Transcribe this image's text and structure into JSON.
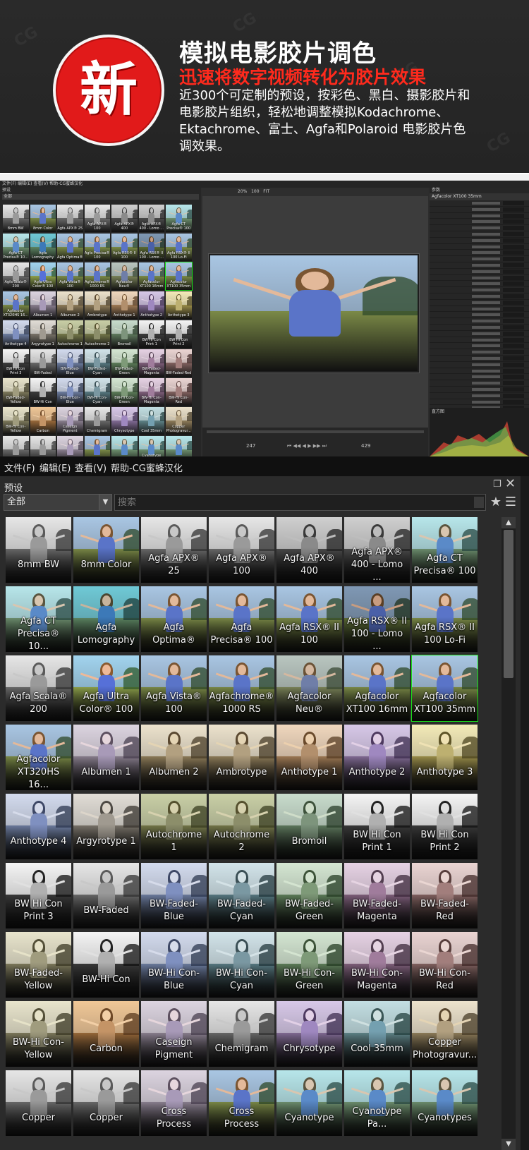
{
  "banner": {
    "badge": "新",
    "headline": "模拟电影胶片调色",
    "subheadline": "迅速将数字视频转化为胶片效果",
    "description": "近300个可定制的预设，按彩色、黑白、摄影胶片和电影胶片组织，轻松地调整模拟Kodachrome、Ektachrome、富士、Agfa和Polaroid 电影胶片色调效果。",
    "watermark": "CG"
  },
  "app_preview": {
    "menu": "文件(F)  编辑(E)  查看(V)  帮助-CG蜜蜂汉化",
    "left_header": "预设",
    "filter": "全部",
    "zoom": "20%",
    "zoom_step": "100",
    "fit": "FIT",
    "frame_in": "247",
    "frame_out": "429",
    "right_header": "参数",
    "preset_name": "Agfacolor XT100 35mm",
    "histogram_label": "直方图"
  },
  "menubar": {
    "items": [
      "文件(F)",
      "编辑(E)",
      "查看(V)",
      "帮助-CG蜜蜂汉化"
    ]
  },
  "presets_panel": {
    "title": "预设",
    "filter_value": "全部",
    "search_placeholder": "搜索",
    "selected_index": 20,
    "items": [
      {
        "label": "8mm BW",
        "tone": "bw"
      },
      {
        "label": "8mm Color",
        "tone": "color"
      },
      {
        "label": "Agfa APX® 25",
        "tone": "bw"
      },
      {
        "label": "Agfa APX® 100",
        "tone": "bw"
      },
      {
        "label": "Agfa APX® 400",
        "tone": "bwdark"
      },
      {
        "label": "Agfa APX® 400 - Lomo ...",
        "tone": "bwdark"
      },
      {
        "label": "Agfa CT Precisa® 100",
        "tone": "cyan"
      },
      {
        "label": "Agfa CT Precisa® 10...",
        "tone": "cyan"
      },
      {
        "label": "Agfa Lomography",
        "tone": "teal"
      },
      {
        "label": "Agfa Optima®",
        "tone": "color"
      },
      {
        "label": "Agfa Precisa® 100",
        "tone": "color"
      },
      {
        "label": "Agfa RSX® II 100",
        "tone": "color"
      },
      {
        "label": "Agfa RSX® II 100 - Lomo ...",
        "tone": "colordark"
      },
      {
        "label": "Agfa RSX® II 100 Lo-Fi",
        "tone": "color"
      },
      {
        "label": "Agfa Scala® 200",
        "tone": "bw"
      },
      {
        "label": "Agfa Ultra Color® 100",
        "tone": "vivid"
      },
      {
        "label": "Agfa Vista® 100",
        "tone": "color"
      },
      {
        "label": "Agfachrome® 1000 RS",
        "tone": "color"
      },
      {
        "label": "Agfacolor Neu®",
        "tone": "muted"
      },
      {
        "label": "Agfacolor XT100 16mm",
        "tone": "color"
      },
      {
        "label": "Agfacolor XT100 35mm",
        "tone": "color"
      },
      {
        "label": "Agfacolor XT320HS 16...",
        "tone": "color"
      },
      {
        "label": "Albumen 1",
        "tone": "lilac"
      },
      {
        "label": "Albumen 2",
        "tone": "sepia"
      },
      {
        "label": "Ambrotype",
        "tone": "sepia"
      },
      {
        "label": "Anthotype 1",
        "tone": "orange"
      },
      {
        "label": "Anthotype 2",
        "tone": "purple"
      },
      {
        "label": "Anthotype 3",
        "tone": "yellow"
      },
      {
        "label": "Anthotype 4",
        "tone": "blue"
      },
      {
        "label": "Argyrotype 1",
        "tone": "warmgray"
      },
      {
        "label": "Autochrome 1",
        "tone": "olive"
      },
      {
        "label": "Autochrome 2",
        "tone": "olive"
      },
      {
        "label": "Bromoil",
        "tone": "green"
      },
      {
        "label": "BW Hi Con Print 1",
        "tone": "bwhi"
      },
      {
        "label": "BW Hi Con Print 2",
        "tone": "bwhi"
      },
      {
        "label": "BW Hi Con Print 3",
        "tone": "bwhi"
      },
      {
        "label": "BW-Faded",
        "tone": "bw"
      },
      {
        "label": "BW-Faded-Blue",
        "tone": "blue"
      },
      {
        "label": "BW-Faded-Cyan",
        "tone": "cyanbw"
      },
      {
        "label": "BW-Faded-Green",
        "tone": "greenbw"
      },
      {
        "label": "BW-Faded-Magenta",
        "tone": "magenta"
      },
      {
        "label": "BW-Faded-Red",
        "tone": "red"
      },
      {
        "label": "BW-Faded-Yellow",
        "tone": "yellowbw"
      },
      {
        "label": "BW-Hi Con",
        "tone": "bwhi"
      },
      {
        "label": "BW-Hi Con-Blue",
        "tone": "blue"
      },
      {
        "label": "BW-Hi Con-Cyan",
        "tone": "cyanbw"
      },
      {
        "label": "BW-Hi Con-Green",
        "tone": "greenbw"
      },
      {
        "label": "BW-Hi Con-Magenta",
        "tone": "magenta"
      },
      {
        "label": "BW-Hi Con-Red",
        "tone": "red"
      },
      {
        "label": "BW-Hi Con-Yellow",
        "tone": "yellowbw"
      },
      {
        "label": "Carbon",
        "tone": "carbon"
      },
      {
        "label": "Caseign Pigment",
        "tone": "lilac"
      },
      {
        "label": "Chemigram",
        "tone": "bw"
      },
      {
        "label": "Chrysotype",
        "tone": "purple"
      },
      {
        "label": "Cool 35mm",
        "tone": "coolteal"
      },
      {
        "label": "Copper Photogravur...",
        "tone": "sepia"
      },
      {
        "label": "Copper",
        "tone": "bw"
      },
      {
        "label": "Copper",
        "tone": "bw"
      },
      {
        "label": "Cross Process",
        "tone": "lilac"
      },
      {
        "label": "Cross Process",
        "tone": "color"
      },
      {
        "label": "Cyanotype",
        "tone": "cyan"
      },
      {
        "label": "Cyanotype Pa...",
        "tone": "cyan"
      },
      {
        "label": "Cyanotypes",
        "tone": "cyan"
      }
    ]
  },
  "colors": {
    "accent_red": "#e11a1a",
    "subhead_red": "#ff2a1d",
    "selection_green": "#18e018"
  }
}
